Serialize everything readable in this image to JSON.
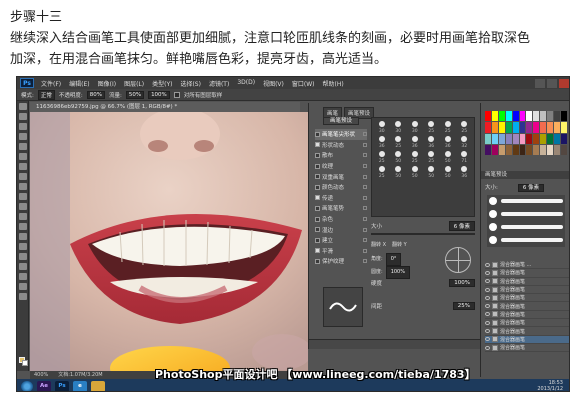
{
  "article": {
    "title": "步骤十三",
    "line1": "继续深入结合画笔工具使面部更加细腻，注意口轮匝肌线条的刻画，必要时用画笔拾取深色",
    "line2": "加深，在用混合画笔抹匀。鲜艳嘴唇色彩，提亮牙齿，高光适当。"
  },
  "app": {
    "logo": "Ps",
    "menu": [
      "文件(F)",
      "编辑(E)",
      "图像(I)",
      "图层(L)",
      "类型(Y)",
      "选择(S)",
      "滤镜(T)",
      "3D(D)",
      "视图(V)",
      "窗口(W)",
      "帮助(H)"
    ],
    "options": {
      "mode_label": "模式:",
      "mode_value": "正常",
      "opacity_label": "不透明度:",
      "opacity_value": "80%",
      "flow_label": "流量:",
      "flow_value": "50%",
      "extra_value": "100%",
      "sample_label": "对所有图层取样"
    },
    "document_tab": "11636986eb92759.jpg @ 66.7% (图层 1, RGB/8#) *",
    "status": {
      "zoom": "400%",
      "doc": "文档:1.07M/3.20M"
    },
    "icons": {
      "start": "windows-start-icon",
      "ae": "after-effects-icon",
      "ps": "photoshop-icon",
      "ie": "internet-explorer-icon",
      "folder": "folder-icon"
    },
    "taskbar_labels": {
      "ae": "Ae",
      "ps": "Ps",
      "ie": "e"
    },
    "clock": {
      "time": "18:53",
      "date": "2013/1/12"
    }
  },
  "brush_panel": {
    "tabs": [
      "画笔",
      "画笔预设"
    ],
    "presets_button": "画笔预设",
    "items": [
      {
        "label": "画笔笔尖形状",
        "checked": false,
        "active": true
      },
      {
        "label": "形状动态",
        "checked": true,
        "active": false
      },
      {
        "label": "散布",
        "checked": false,
        "active": false
      },
      {
        "label": "纹理",
        "checked": false,
        "active": false
      },
      {
        "label": "双重画笔",
        "checked": false,
        "active": false
      },
      {
        "label": "颜色动态",
        "checked": false,
        "active": false
      },
      {
        "label": "传递",
        "checked": true,
        "active": false
      },
      {
        "label": "画笔笔势",
        "checked": false,
        "active": false
      },
      {
        "label": "杂色",
        "checked": false,
        "active": false
      },
      {
        "label": "湿边",
        "checked": false,
        "active": false
      },
      {
        "label": "建立",
        "checked": false,
        "active": false
      },
      {
        "label": "平滑",
        "checked": true,
        "active": false
      },
      {
        "label": "保护纹理",
        "checked": false,
        "active": false
      }
    ],
    "tip_sizes": [
      "30",
      "30",
      "30",
      "25",
      "25",
      "25",
      "36",
      "25",
      "36",
      "36",
      "36",
      "32",
      "25",
      "50",
      "25",
      "25",
      "50",
      "71",
      "25",
      "50",
      "50",
      "50",
      "50",
      "36"
    ],
    "size_label": "大小",
    "size_value": "6 像素",
    "flip_x": "翻转 X",
    "flip_y": "翻转 Y",
    "angle_label": "角度:",
    "angle_value": "0°",
    "roundness_label": "圆度:",
    "roundness_value": "100%",
    "hardness_label": "硬度",
    "hardness_value": "100%",
    "spacing_label": "间距",
    "spacing_value": "25%"
  },
  "right_panel": {
    "swatches": [
      "#ff0000",
      "#ffff00",
      "#00ff00",
      "#00ffff",
      "#0000ff",
      "#ff00ff",
      "#ffffff",
      "#e0e0e0",
      "#c0c0c0",
      "#808080",
      "#404040",
      "#000000",
      "#ee1c24",
      "#f7941d",
      "#fff200",
      "#00a651",
      "#00aeef",
      "#2e3192",
      "#92278f",
      "#ec008c",
      "#f26c4f",
      "#f68e55",
      "#fbaf5d",
      "#fff568",
      "#7accc8",
      "#6dcff6",
      "#7da7d9",
      "#8781bd",
      "#a186be",
      "#f49ac2",
      "#9e0b0f",
      "#a0410d",
      "#aba000",
      "#007236",
      "#0076a3",
      "#1b1464",
      "#440e62",
      "#9e005d",
      "#c69c6d",
      "#8c6239",
      "#603913",
      "#3c2415",
      "#754c24",
      "#a67c52",
      "#c7b299",
      "#e6d6c4",
      "#998675",
      "#534741"
    ],
    "brush_presets_title": "画笔预设",
    "size_label": "大小:",
    "size_value": "6 像素",
    "layers": [
      "混合器画笔 ...",
      "混合器画笔",
      "混合器画笔",
      "混合器画笔",
      "混合器画笔",
      "混合器画笔",
      "混合器画笔",
      "混合器画笔",
      "混合器画笔",
      "混合器画笔",
      "混合器画笔"
    ],
    "layer_selected_index": 9
  },
  "watermark": "PhotoShop平面设计吧 【www.lineeg.com/tieba/1783】"
}
